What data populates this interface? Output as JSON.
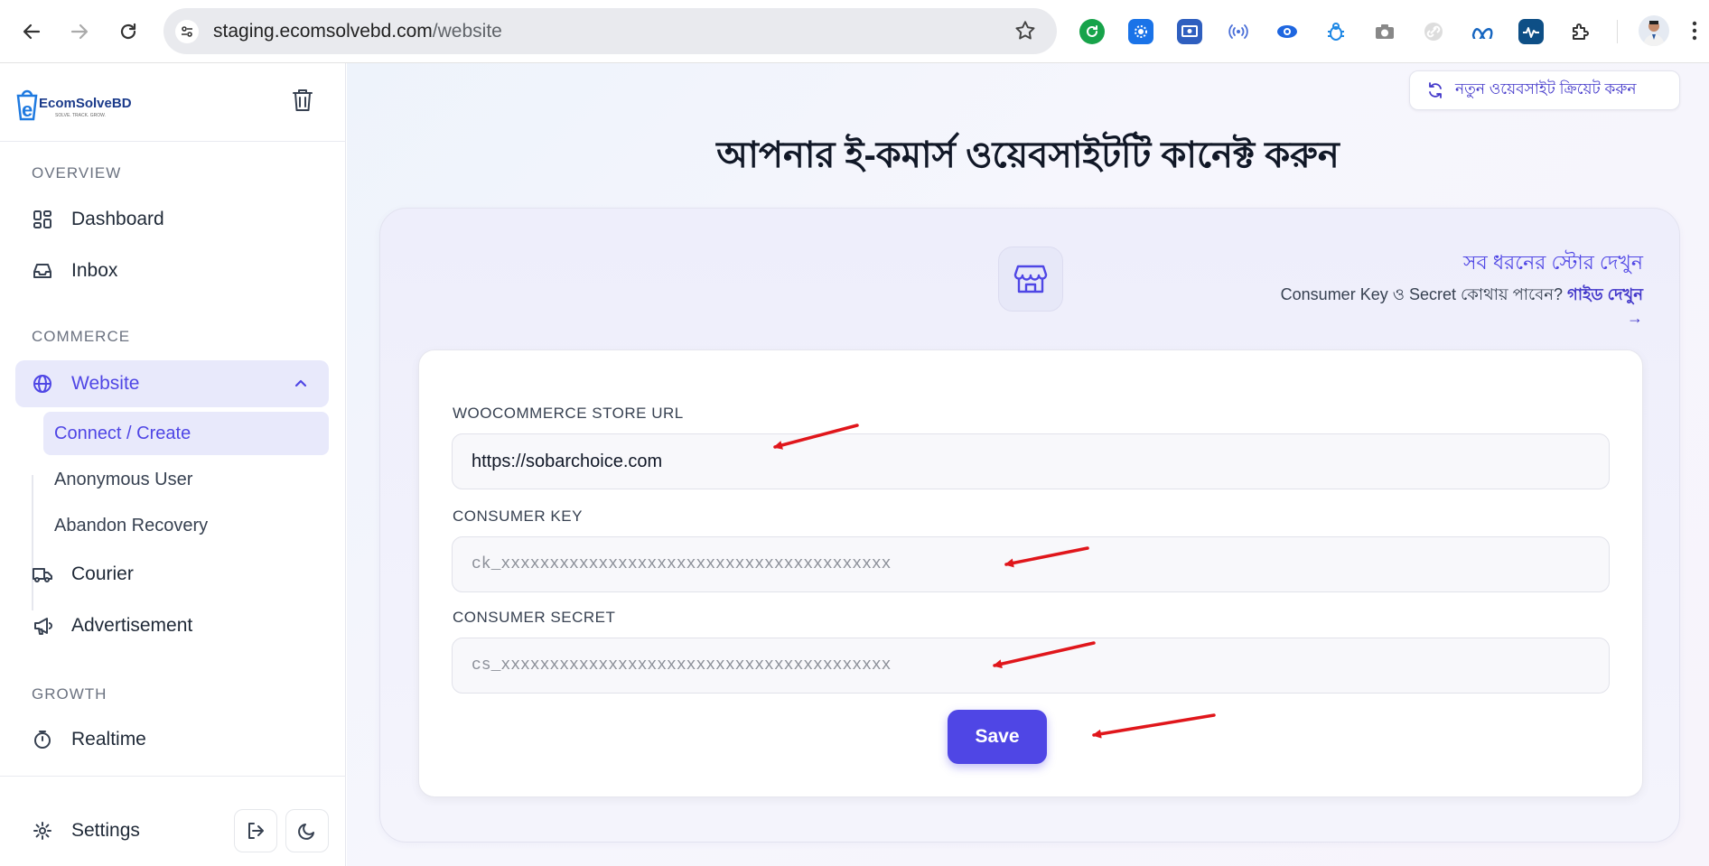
{
  "browser": {
    "url_host": "staging.ecomsolvebd.com",
    "url_path": "/website"
  },
  "sidebar": {
    "logo_text": "EcomSolveBD",
    "logo_tagline": "SOLVE. TRACK. GROW.",
    "sections": {
      "overview": "OVERVIEW",
      "commerce": "COMMERCE",
      "growth": "GROWTH"
    },
    "items": {
      "dashboard": "Dashboard",
      "inbox": "Inbox",
      "website": "Website",
      "courier": "Courier",
      "advertisement": "Advertisement",
      "realtime": "Realtime",
      "settings": "Settings"
    },
    "subitems": {
      "connect_create": "Connect / Create",
      "anonymous_user": "Anonymous User",
      "abandon_recovery": "Abandon Recovery"
    }
  },
  "main": {
    "create_button": "নতুন ওয়েবসাইট ক্রিয়েট করুন",
    "title": "আপনার ই-কমার্স ওয়েবসাইটটি কানেক্ট করুন",
    "all_stores_link": "সব ধরনের স্টোর দেখুন",
    "guide_text": "Consumer Key ও Secret কোথায় পাবেন?",
    "guide_link": "গাইড দেখুন →",
    "form": {
      "store_url_label": "WOOCOMMERCE STORE URL",
      "store_url_value": "https://sobarchoice.com",
      "consumer_key_label": "CONSUMER KEY",
      "consumer_key_placeholder": "ck_xxxxxxxxxxxxxxxxxxxxxxxxxxxxxxxxxxxxxxxx",
      "consumer_secret_label": "CONSUMER SECRET",
      "consumer_secret_placeholder": "cs_xxxxxxxxxxxxxxxxxxxxxxxxxxxxxxxxxxxxxxxx",
      "save_label": "Save"
    }
  },
  "colors": {
    "accent": "#4f46e5",
    "annotation_arrow": "#e0161b"
  }
}
